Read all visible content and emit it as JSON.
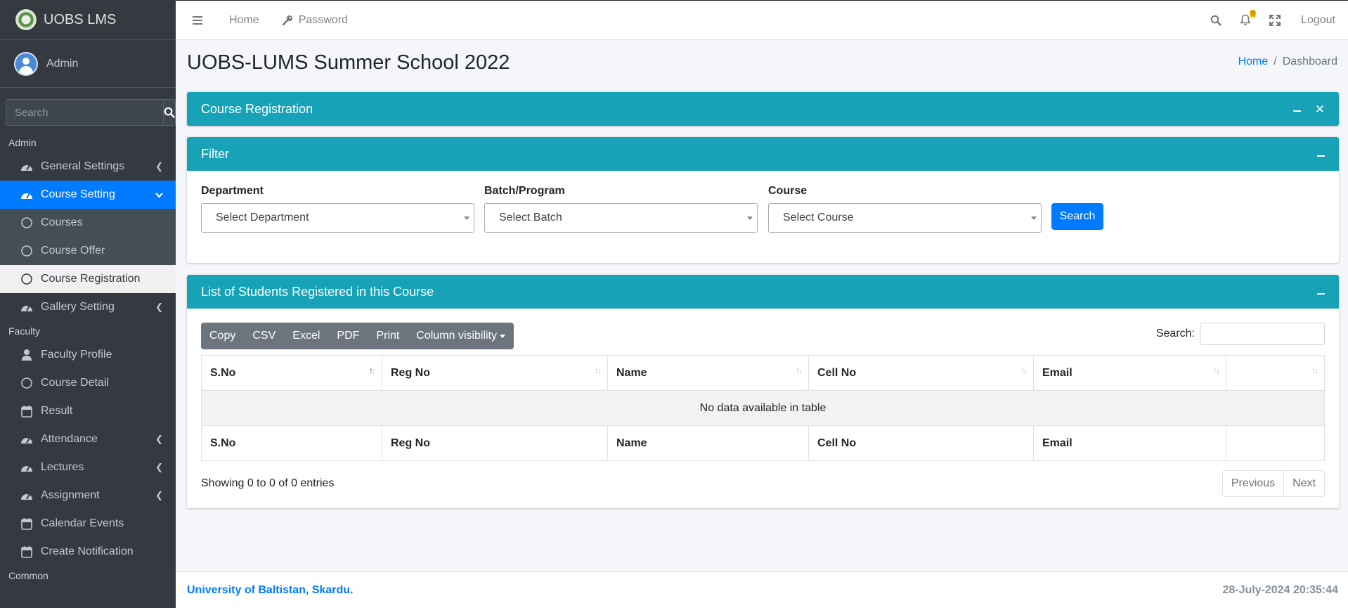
{
  "brand": {
    "title": "UOBS LMS"
  },
  "user": {
    "name": "Admin"
  },
  "sidebar": {
    "search_placeholder": "Search",
    "sections": [
      {
        "header": "Admin",
        "items": [
          {
            "label": "General Settings",
            "icon": "gauge-icon",
            "arrow": "‹"
          },
          {
            "label": "Course Setting",
            "icon": "gauge-icon",
            "arrow": "⌄",
            "active": true
          },
          {
            "label": "Courses",
            "icon": "circle-icon",
            "sub": true
          },
          {
            "label": "Course Offer",
            "icon": "circle-icon",
            "sub": true
          },
          {
            "label": "Course Registration",
            "icon": "circle-icon",
            "sub": true,
            "current": true
          },
          {
            "label": "Gallery Setting",
            "icon": "gauge-icon",
            "arrow": "‹"
          }
        ]
      },
      {
        "header": "Faculty",
        "items": [
          {
            "label": "Faculty Profile",
            "icon": "user-icon"
          },
          {
            "label": "Course Detail",
            "icon": "circle-icon"
          },
          {
            "label": "Result",
            "icon": "calendar-icon"
          },
          {
            "label": "Attendance",
            "icon": "gauge-icon",
            "arrow": "‹"
          },
          {
            "label": "Lectures",
            "icon": "gauge-icon",
            "arrow": "‹"
          },
          {
            "label": "Assignment",
            "icon": "gauge-icon",
            "arrow": "‹"
          },
          {
            "label": "Calendar Events",
            "icon": "calendar-icon"
          },
          {
            "label": "Create Notification",
            "icon": "calendar-icon"
          }
        ]
      },
      {
        "header": "Common",
        "items": []
      }
    ]
  },
  "topbar": {
    "home": "Home",
    "password": "Password",
    "notification_count": "0",
    "logout": "Logout"
  },
  "page": {
    "title": "UOBS-LUMS Summer School 2022",
    "breadcrumb": {
      "home": "Home",
      "sep": "/",
      "current": "Dashboard"
    }
  },
  "course_registration_card": {
    "title": "Course Registration"
  },
  "filter_card": {
    "title": "Filter",
    "department_label": "Department",
    "department_value": "Select Department",
    "batch_label": "Batch/Program",
    "batch_value": "Select Batch",
    "course_label": "Course",
    "course_value": "Select Course",
    "search_button": "Search"
  },
  "students_card": {
    "title": "List of Students Registered in this Course",
    "buttons": [
      "Copy",
      "CSV",
      "Excel",
      "PDF",
      "Print"
    ],
    "column_visibility": "Column visibility",
    "search_label": "Search:",
    "columns": [
      "S.No",
      "Reg No",
      "Name",
      "Cell No",
      "Email",
      ""
    ],
    "empty_text": "No data available in table",
    "info": "Showing 0 to 0 of 0 entries",
    "previous": "Previous",
    "next": "Next"
  },
  "footer": {
    "university": "University of Baltistan, Skardu.",
    "datetime": "28-July-2024 20:35:44"
  },
  "colors": {
    "primary": "#007bff",
    "info": "#17a2b8",
    "sidebar": "#343a40",
    "secondary": "#6c757d"
  }
}
